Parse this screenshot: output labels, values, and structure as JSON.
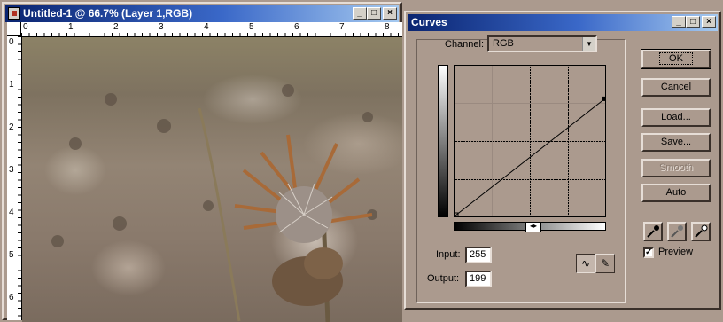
{
  "image_window": {
    "title": "Untitled-1 @ 66.7% (Layer 1,RGB)",
    "ruler_top_labels": [
      "0",
      "1",
      "2",
      "3",
      "4",
      "5",
      "6",
      "7",
      "8"
    ],
    "ruler_left_labels": [
      "0",
      "1",
      "2",
      "3",
      "4",
      "5",
      "6"
    ]
  },
  "curves": {
    "title": "Curves",
    "channel_label": "Channel:",
    "channel_value": "RGB",
    "input_label": "Input:",
    "input_value": "255",
    "output_label": "Output:",
    "output_value": "199",
    "buttons": {
      "ok": "OK",
      "cancel": "Cancel",
      "load": "Load...",
      "save": "Save...",
      "smooth": "Smooth",
      "auto": "Auto"
    },
    "preview_label": "Preview",
    "preview_checked": true,
    "curve_endpoint": {
      "input": 255,
      "output": 199
    }
  },
  "window_controls": {
    "minimize": "_",
    "maximize": "□",
    "close": "×"
  }
}
